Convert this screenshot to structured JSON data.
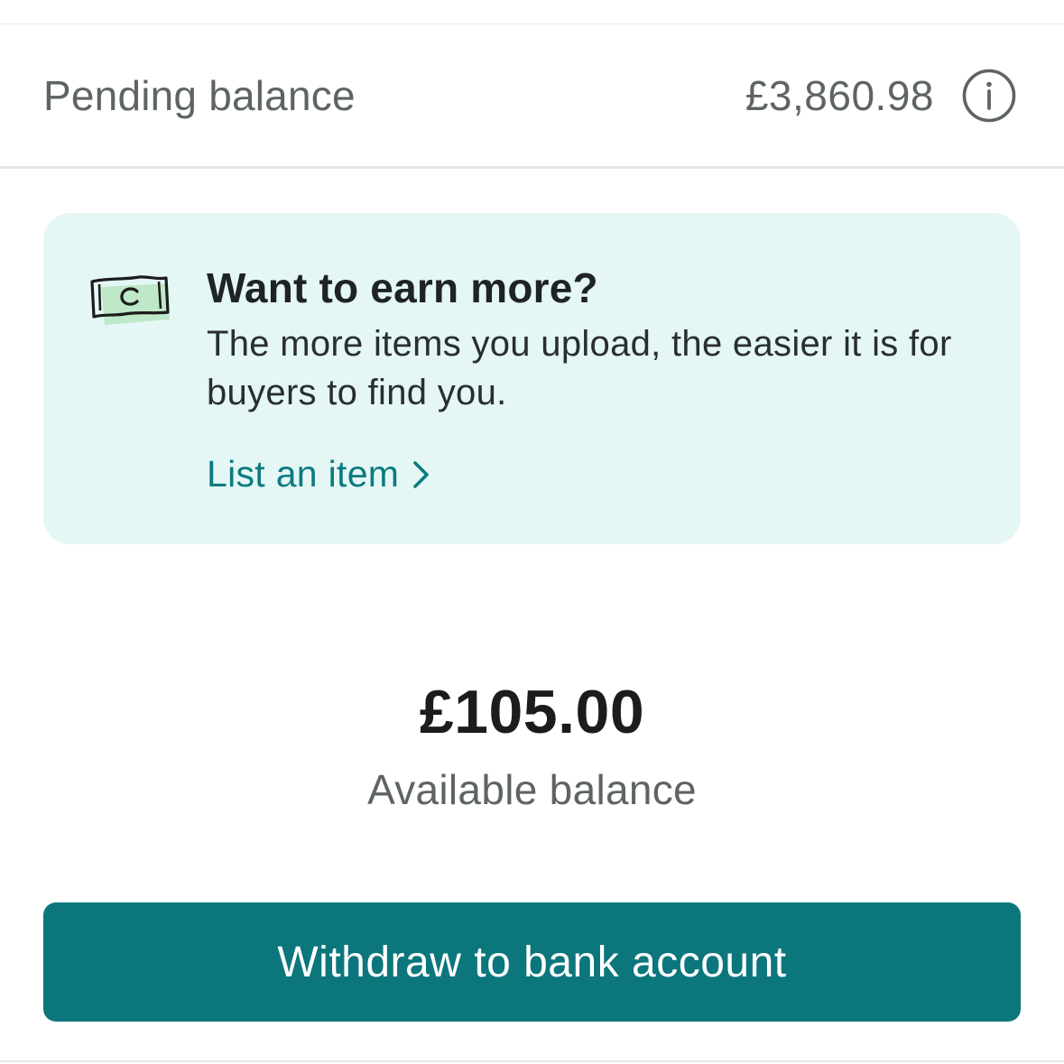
{
  "pending": {
    "label": "Pending balance",
    "amount": "£3,860.98",
    "icon": "info-icon"
  },
  "promo": {
    "icon": "money-icon",
    "title": "Want to earn more?",
    "body": "The more items you upload, the easier it is for buyers to find you.",
    "link_label": "List an item",
    "link_icon": "chevron-right-icon",
    "background_color": "#e4f7f5",
    "link_color": "#0b7b7f"
  },
  "available": {
    "amount": "£105.00",
    "label": "Available balance"
  },
  "withdraw": {
    "label": "Withdraw to bank account",
    "color": "#0b767c"
  }
}
